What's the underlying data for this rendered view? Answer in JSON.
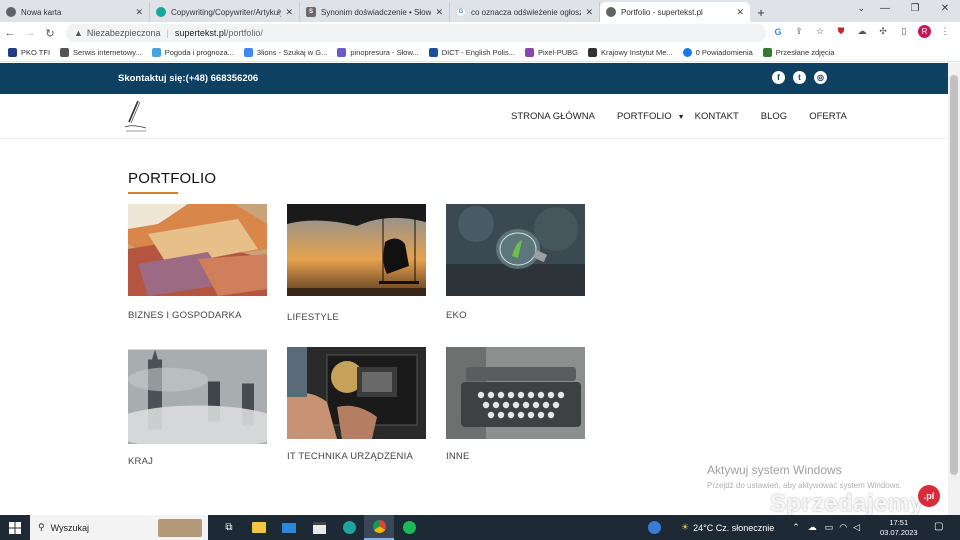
{
  "browser": {
    "tabs": [
      {
        "title": "Nowa karta",
        "icon": "chrome-icon",
        "color": "#5f6368"
      },
      {
        "title": "Copywriting/Copywriter/Artykuły",
        "icon": "site-icon",
        "color": "#14a89a"
      },
      {
        "title": "Synonim doświadczenie • Słowni",
        "icon": "s-icon",
        "color": "#6b6b6b"
      },
      {
        "title": "co oznacza odświeżenie ogłosze",
        "icon": "google-icon",
        "color": "#4285f4"
      },
      {
        "title": "Portfolio - supertekst.pl",
        "icon": "globe-icon",
        "color": "#5f6368"
      }
    ],
    "close_glyph": "✕",
    "new_tab": "+",
    "address": {
      "insecure_label": "Niezabezpieczona",
      "host": "supertekst.pl",
      "path": "/portfolio/"
    },
    "profile_initial": "R",
    "bookmarks": [
      {
        "label": "PKO TFI",
        "color": "#1f3c88"
      },
      {
        "label": "Serwis internetowy...",
        "color": "#555"
      },
      {
        "label": "Pogoda i prognoza...",
        "color": "#4aa3df"
      },
      {
        "label": "3lions - Szukaj w G...",
        "color": "#4285f4"
      },
      {
        "label": "pinopresura - Słow...",
        "color": "#6a5acd"
      },
      {
        "label": "DICT - English Polis...",
        "color": "#1a4fa0"
      },
      {
        "label": "Pixel-PUBG",
        "color": "#8e44ad"
      },
      {
        "label": "Krajowy Instytut Me...",
        "color": "#333"
      },
      {
        "label": "0 Powiadomienia",
        "color": "#1877f2"
      },
      {
        "label": "Przesłane zdjęcia",
        "color": "#2e7d32"
      }
    ]
  },
  "site": {
    "contact": "Skontaktuj się:(+48) 668356206",
    "social": [
      "f",
      "t",
      "ig"
    ],
    "menu": [
      "STRONA GŁÓWNA",
      "PORTFOLIO",
      "KONTAKT",
      "BLOG",
      "OFERTA"
    ],
    "menu_caret": "▼",
    "title": "PORTFOLIO",
    "cards": [
      {
        "label": "BIZNES I GOSPODARKA"
      },
      {
        "label": "LIFESTYLE"
      },
      {
        "label": "EKO"
      },
      {
        "label": "KRAJ"
      },
      {
        "label": "IT TECHNIKA URZĄDZENIA"
      },
      {
        "label": "INNE"
      }
    ],
    "accent": "#d9822b",
    "topbar_color": "#0d4061"
  },
  "watermark": {
    "activate_title": "Aktywuj system Windows",
    "activate_sub": "Przejdź do ustawień, aby aktywować system Windows.",
    "brand": "Sprzedajemy",
    "brand_suffix": ".pl"
  },
  "taskbar": {
    "search": "Wyszukaj",
    "weather": "24°C  Cz. słonecznie",
    "time": "17:51",
    "date": "03.07.2023"
  }
}
